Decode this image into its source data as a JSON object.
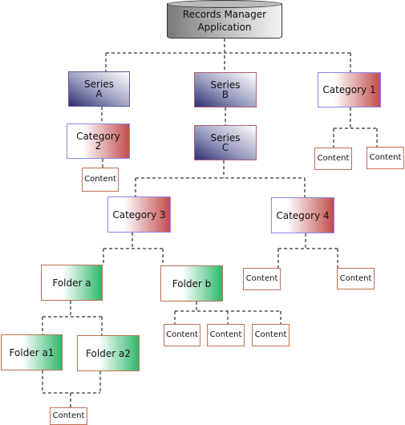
{
  "root": {
    "line1": "Records Manager",
    "line2": "Application"
  },
  "nodes": {
    "series_a": {
      "line1": "Series",
      "line2": "A"
    },
    "series_b": {
      "line1": "Series",
      "line2": "B"
    },
    "series_c": {
      "line1": "Series",
      "line2": "C"
    },
    "category_1": "Category 1",
    "category_2": {
      "line1": "Category",
      "line2": "2"
    },
    "category_3": "Category 3",
    "category_4": "Category 4",
    "folder_a": "Folder a",
    "folder_b": "Folder b",
    "folder_a1": "Folder a1",
    "folder_a2": "Folder a2"
  },
  "content_label": "Content",
  "colors": {
    "series": "#2e3070",
    "category": "#c24d4d",
    "folder": "#2fb86a",
    "connector": "#555555"
  }
}
